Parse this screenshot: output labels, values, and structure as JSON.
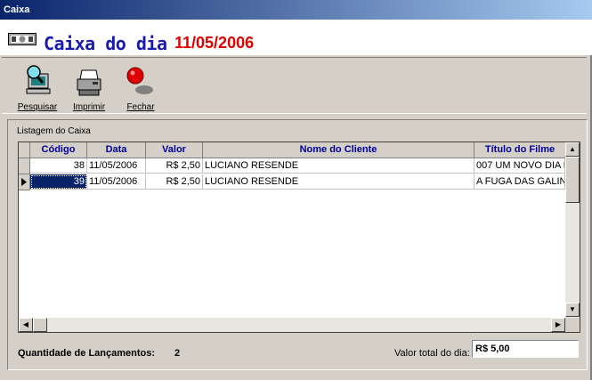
{
  "window": {
    "title": "Caixa"
  },
  "header": {
    "title": "Caixa do dia",
    "date": "11/05/2006"
  },
  "toolbar": {
    "buttons": [
      {
        "label": "Pesquisar",
        "icon": "search-computer-icon"
      },
      {
        "label": "Imprimir",
        "icon": "printer-icon"
      },
      {
        "label": "Fechar",
        "icon": "red-light-icon"
      }
    ]
  },
  "panel": {
    "label": "Listagem do Caixa"
  },
  "grid": {
    "columns": [
      "Código",
      "Data",
      "Valor",
      "Nome do Cliente",
      "Título do Filme"
    ],
    "rows": [
      {
        "codigo": "38",
        "data": "11/05/2006",
        "valor": "R$ 2,50",
        "cliente": "LUCIANO RESENDE",
        "filme": "007 UM NOVO DIA P"
      },
      {
        "codigo": "39",
        "data": "11/05/2006",
        "valor": "R$ 2,50",
        "cliente": "LUCIANO RESENDE",
        "filme": "A FUGA DAS GALIN"
      }
    ],
    "selected_row": 2
  },
  "footer": {
    "qty_label": "Quantidade de Lançamentos:",
    "qty_value": "2",
    "total_label": "Valor total do dia:",
    "total_value": "R$ 5,00"
  }
}
